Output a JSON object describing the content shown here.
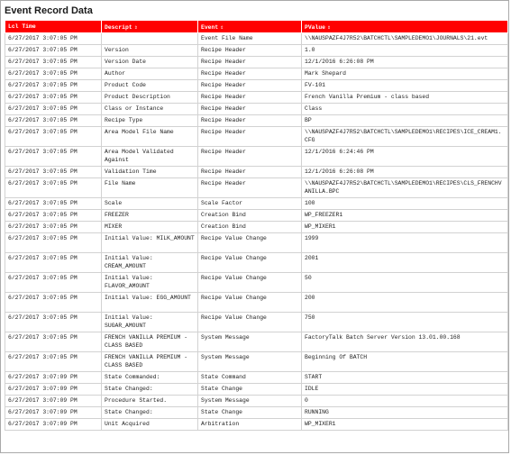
{
  "window": {
    "title": "Event Record Data"
  },
  "table": {
    "columns": [
      {
        "label": "Lcl Time",
        "sortable": false
      },
      {
        "label": "Descript",
        "sortable": true
      },
      {
        "label": "Event",
        "sortable": true
      },
      {
        "label": "PValue",
        "sortable": true
      }
    ],
    "sort_glyph": "⇕",
    "rows": [
      [
        "6/27/2017 3:07:05 PM",
        "",
        "Event File Name",
        "\\\\NAUSPAZF4J7R52\\BATCHCTL\\SAMPLEDEMO1\\JOURNALS\\21.evt"
      ],
      [
        "6/27/2017 3:07:05 PM",
        "Version",
        "Recipe Header",
        "1.0"
      ],
      [
        "6/27/2017 3:07:05 PM",
        "Version Date",
        "Recipe Header",
        "12/1/2016 6:26:08 PM"
      ],
      [
        "6/27/2017 3:07:05 PM",
        "Author",
        "Recipe Header",
        "Mark Shepard"
      ],
      [
        "6/27/2017 3:07:05 PM",
        "Product Code",
        "Recipe Header",
        "FV-101"
      ],
      [
        "6/27/2017 3:07:05 PM",
        "Product Description",
        "Recipe Header",
        "French Vanilla Premium - class based"
      ],
      [
        "6/27/2017 3:07:05 PM",
        "Class or Instance",
        "Recipe Header",
        "Class"
      ],
      [
        "6/27/2017 3:07:05 PM",
        "Recipe Type",
        "Recipe Header",
        "BP"
      ],
      [
        "6/27/2017 3:07:05 PM",
        "Area Model File Name",
        "Recipe Header",
        "\\\\NAUSPAZF4J7R52\\BATCHCTL\\SAMPLEDEMO1\\RECIPES\\ICE_CREAM1.CFG"
      ],
      [
        "6/27/2017 3:07:05 PM",
        "Area Model Validated Against",
        "Recipe Header",
        "12/1/2016 6:24:46 PM"
      ],
      [
        "6/27/2017 3:07:05 PM",
        "Validation Time",
        "Recipe Header",
        "12/1/2016 6:26:08 PM"
      ],
      [
        "6/27/2017 3:07:05 PM",
        "File Name",
        "Recipe Header",
        "\\\\NAUSPAZF4J7R52\\BATCHCTL\\SAMPLEDEMO1\\RECIPES\\CLS_FRENCHVANILLA.BPC"
      ],
      [
        "6/27/2017 3:07:05 PM",
        "Scale",
        "Scale Factor",
        "100"
      ],
      [
        "6/27/2017 3:07:05 PM",
        "FREEZER",
        "Creation Bind",
        "WP_FREEZER1"
      ],
      [
        "6/27/2017 3:07:05 PM",
        "MIXER",
        "Creation Bind",
        "WP_MIXER1"
      ],
      [
        "6/27/2017 3:07:05 PM",
        "Initial Value: MILK_AMOUNT",
        "Recipe Value Change",
        "1999"
      ],
      [
        "6/27/2017 3:07:05 PM",
        "Initial Value: CREAM_AMOUNT",
        "Recipe Value Change",
        "2001"
      ],
      [
        "6/27/2017 3:07:05 PM",
        "Initial Value: FLAVOR_AMOUNT",
        "Recipe Value Change",
        "50"
      ],
      [
        "6/27/2017 3:07:05 PM",
        "Initial Value: EGG_AMOUNT",
        "Recipe Value Change",
        "200"
      ],
      [
        "6/27/2017 3:07:05 PM",
        "Initial Value: SUGAR_AMOUNT",
        "Recipe Value Change",
        "750"
      ],
      [
        "6/27/2017 3:07:05 PM",
        "FRENCH VANILLA PREMIUM - CLASS BASED",
        "System Message",
        "FactoryTalk Batch Server Version 13.01.00.168"
      ],
      [
        "6/27/2017 3:07:05 PM",
        "FRENCH VANILLA PREMIUM - CLASS BASED",
        "System Message",
        "Beginning Of BATCH"
      ],
      [
        "6/27/2017 3:07:09 PM",
        "State Commanded:",
        "State Command",
        "START"
      ],
      [
        "6/27/2017 3:07:09 PM",
        "State Changed:",
        "State Change",
        "IDLE"
      ],
      [
        "6/27/2017 3:07:09 PM",
        "Procedure Started.",
        "System Message",
        "0"
      ],
      [
        "6/27/2017 3:07:09 PM",
        "State Changed:",
        "State Change",
        "RUNNING"
      ],
      [
        "6/27/2017 3:07:09 PM",
        "Unit Acquired",
        "Arbitration",
        "WP_MIXER1"
      ]
    ]
  },
  "colors": {
    "header_bg": "#ff0000",
    "header_text": "#ffffff",
    "grid_line": "#d2d2d2"
  }
}
